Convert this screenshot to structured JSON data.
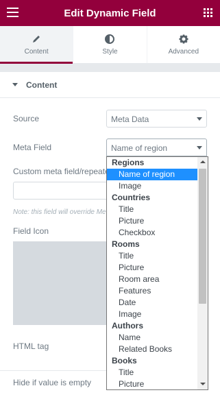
{
  "header": {
    "title": "Edit Dynamic Field",
    "menu_icon": "hamburger-icon",
    "widgets_icon": "grid-icon",
    "bg_color": "#93003c"
  },
  "tabs": [
    {
      "label": "Content",
      "icon": "pencil-icon",
      "active": true
    },
    {
      "label": "Style",
      "icon": "half-circle-icon",
      "active": false
    },
    {
      "label": "Advanced",
      "icon": "gear-icon",
      "active": false
    }
  ],
  "section": {
    "title": "Content"
  },
  "fields": {
    "source_label": "Source",
    "source_value": "Meta Data",
    "meta_field_label": "Meta Field",
    "meta_field_value": "Name of region",
    "custom_meta_label": "Custom meta field/repeater key",
    "note": "Note: this field will override Meta Field value",
    "field_icon_label": "Field Icon",
    "html_tag_label": "HTML tag",
    "hide_empty_label": "Hide if value is empty"
  },
  "dropdown": {
    "rows": [
      {
        "type": "group",
        "text": "Regions"
      },
      {
        "type": "option",
        "text": "Name of region",
        "selected": true
      },
      {
        "type": "option",
        "text": "Image"
      },
      {
        "type": "group",
        "text": "Countries"
      },
      {
        "type": "option",
        "text": "Title"
      },
      {
        "type": "option",
        "text": "Picture"
      },
      {
        "type": "option",
        "text": "Checkbox"
      },
      {
        "type": "group",
        "text": "Rooms"
      },
      {
        "type": "option",
        "text": "Title"
      },
      {
        "type": "option",
        "text": "Picture"
      },
      {
        "type": "option",
        "text": "Room area"
      },
      {
        "type": "option",
        "text": "Features"
      },
      {
        "type": "option",
        "text": "Date"
      },
      {
        "type": "option",
        "text": "Image"
      },
      {
        "type": "group",
        "text": "Authors"
      },
      {
        "type": "option",
        "text": "Name"
      },
      {
        "type": "option",
        "text": "Related Books"
      },
      {
        "type": "group",
        "text": "Books"
      },
      {
        "type": "option",
        "text": "Title"
      },
      {
        "type": "option",
        "text": "Picture"
      }
    ],
    "selected_color": "#1e90ff"
  }
}
